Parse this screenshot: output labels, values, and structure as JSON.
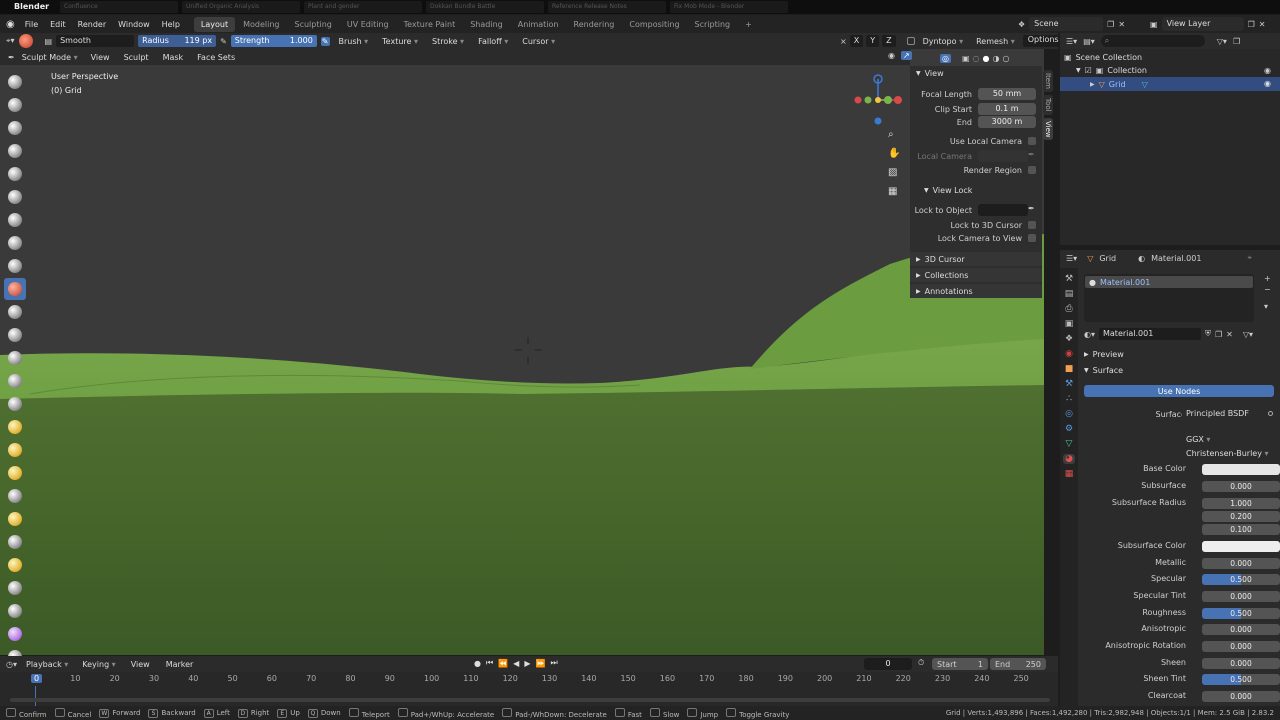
{
  "app": {
    "name": "Blender"
  },
  "browser_tabs": [
    "Confluence",
    "Unified Organic Analysis",
    "Plant and gender",
    "Dokkan Bundle Battle",
    "Reference Release Notes",
    "Fix Mob Mode - Blender"
  ],
  "menu": {
    "items": [
      "File",
      "Edit",
      "Render",
      "Window",
      "Help"
    ]
  },
  "workspaces": {
    "tabs": [
      "Layout",
      "Modeling",
      "Sculpting",
      "UV Editing",
      "Texture Paint",
      "Shading",
      "Animation",
      "Rendering",
      "Compositing",
      "Scripting"
    ],
    "active": "Layout",
    "add": "+"
  },
  "scene": {
    "name": "Scene",
    "view_layer": "View Layer"
  },
  "tool_header": {
    "brush_name": "Smooth",
    "radius_label": "Radius",
    "radius_value": "119 px",
    "strength_label": "Strength",
    "strength_value": "1.000",
    "menus": [
      "Brush",
      "Texture",
      "Stroke",
      "Falloff",
      "Cursor"
    ],
    "axes": [
      "X",
      "Y",
      "Z"
    ],
    "dyntopo": "Dyntopo",
    "remesh": "Remesh",
    "options": "Options"
  },
  "mode_header": {
    "mode": "Sculpt Mode",
    "menus": [
      "View",
      "Sculpt",
      "Mask",
      "Face Sets"
    ]
  },
  "viewport": {
    "perspective": "User Perspective",
    "object": "(0) Grid",
    "ground_color": "#4b6a2f",
    "hill_color": "#6a9a3f",
    "sky_color": "#3a3a3a",
    "accent": "#4772b3"
  },
  "npanel": {
    "tabs": [
      "Item",
      "Tool",
      "View"
    ],
    "view_title": "View",
    "focal_label": "Focal Length",
    "focal_value": "50 mm",
    "clip_start_label": "Clip Start",
    "clip_start_value": "0.1 m",
    "end_label": "End",
    "end_value": "3000 m",
    "use_local_camera": "Use Local Camera",
    "local_camera": "Local Camera",
    "render_region": "Render Region",
    "view_lock_title": "View Lock",
    "lock_to_object": "Lock to Object",
    "lock_3d_cursor": "Lock to 3D Cursor",
    "lock_camera": "Lock Camera to View",
    "cursor_3d": "3D Cursor",
    "collections": "Collections",
    "annotations": "Annotations"
  },
  "outliner": {
    "root": "Scene Collection",
    "collection": "Collection",
    "object": "Grid"
  },
  "properties": {
    "object": "Grid",
    "material": "Material.001",
    "slot": "Material.001",
    "datablock": "Material.001",
    "preview": "Preview",
    "surface": "Surface",
    "use_nodes": "Use Nodes",
    "surface_label": "Surface",
    "surface_value": "Principled BSDF",
    "distribution": "GGX",
    "subsurface_method": "Christensen-Burley",
    "rows": [
      {
        "label": "Base Color",
        "value": "",
        "type": "color",
        "color": "#e6e6e6"
      },
      {
        "label": "Subsurface",
        "value": "0.000"
      },
      {
        "label": "Subsurface Radius",
        "value": "1.000"
      },
      {
        "label": "",
        "value": "0.200"
      },
      {
        "label": "",
        "value": "0.100"
      },
      {
        "label": "Subsurface Color",
        "value": "",
        "type": "color",
        "color": "#eeeeee"
      },
      {
        "label": "Metallic",
        "value": "0.000"
      },
      {
        "label": "Specular",
        "value": "0.500",
        "fill": 0.5
      },
      {
        "label": "Specular Tint",
        "value": "0.000"
      },
      {
        "label": "Roughness",
        "value": "0.500",
        "fill": 0.5
      },
      {
        "label": "Anisotropic",
        "value": "0.000"
      },
      {
        "label": "Anisotropic Rotation",
        "value": "0.000"
      },
      {
        "label": "Sheen",
        "value": "0.000"
      },
      {
        "label": "Sheen Tint",
        "value": "0.500",
        "fill": 0.5
      },
      {
        "label": "Clearcoat",
        "value": "0.000"
      }
    ]
  },
  "timeline": {
    "menus": [
      "Playback",
      "Keying",
      "View",
      "Marker"
    ],
    "current_frame": "0",
    "start_label": "Start",
    "start": "1",
    "end_label": "End",
    "end": "250",
    "ticks": [
      "0",
      "10",
      "20",
      "30",
      "40",
      "50",
      "60",
      "70",
      "80",
      "90",
      "100",
      "110",
      "120",
      "130",
      "140",
      "150",
      "160",
      "170",
      "180",
      "190",
      "200",
      "210",
      "220",
      "230",
      "240",
      "250"
    ]
  },
  "statusbar": {
    "items": [
      {
        "key": "",
        "label": "Confirm"
      },
      {
        "key": "",
        "label": "Cancel"
      },
      {
        "key": "W",
        "label": "Forward"
      },
      {
        "key": "S",
        "label": "Backward"
      },
      {
        "key": "A",
        "label": "Left"
      },
      {
        "key": "D",
        "label": "Right"
      },
      {
        "key": "E",
        "label": "Up"
      },
      {
        "key": "Q",
        "label": "Down"
      },
      {
        "key": "",
        "label": "Teleport"
      },
      {
        "key": "",
        "label": "Pad+/WhUp: Accelerate"
      },
      {
        "key": "",
        "label": "Pad-/WhDown: Decelerate"
      },
      {
        "key": "",
        "label": "Fast"
      },
      {
        "key": "",
        "label": "Slow"
      },
      {
        "key": "",
        "label": "Jump"
      },
      {
        "key": "",
        "label": "Toggle Gravity"
      }
    ],
    "stats": "Grid | Verts:1,493,896 | Faces:1,492,280 | Tris:2,982,948 | Objects:1/1 | Mem: 2.5 GiB | 2.83.2"
  }
}
